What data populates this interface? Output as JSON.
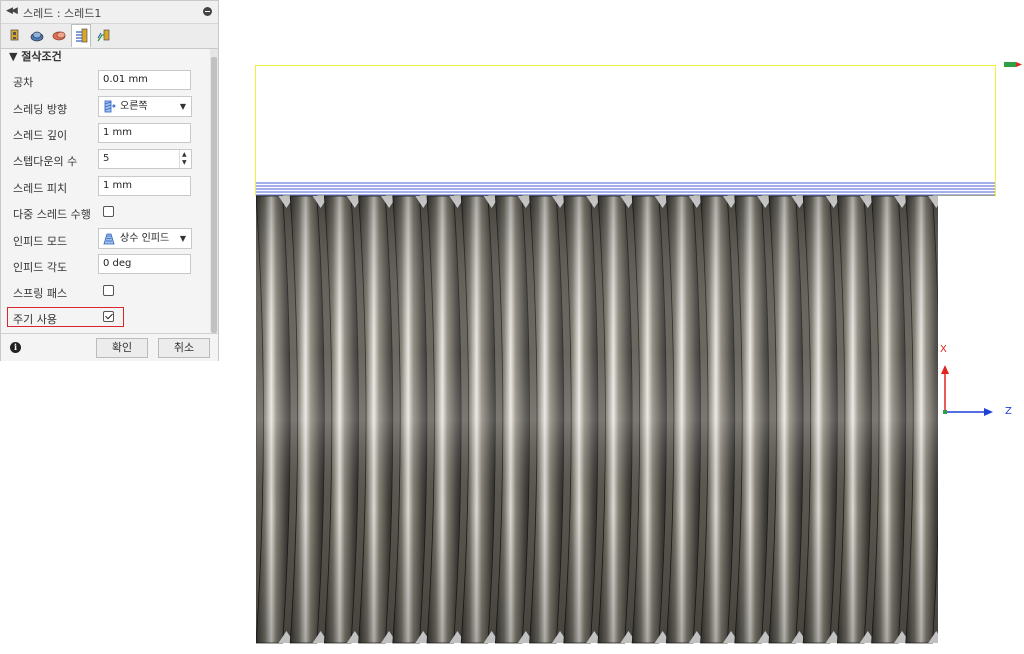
{
  "dialog": {
    "title": "스레드 : 스레드1",
    "section_title": "절삭조건",
    "tabs": [
      {
        "name": "tool-tab"
      },
      {
        "name": "geometry-tab"
      },
      {
        "name": "heights-tab"
      },
      {
        "name": "passes-tab",
        "active": true
      },
      {
        "name": "linking-tab"
      }
    ],
    "rows": [
      {
        "label": "공차",
        "type": "text",
        "value": "0.01 mm"
      },
      {
        "label": "스레딩 방향",
        "type": "dropdown",
        "value": "오른쪽"
      },
      {
        "label": "스레드 깊이",
        "type": "text",
        "value": "1 mm"
      },
      {
        "label": "스텝다운의 수",
        "type": "spinner",
        "value": "5"
      },
      {
        "label": "스레드 피치",
        "type": "text",
        "value": "1 mm"
      },
      {
        "label": "다중 스레드 수행",
        "type": "checkbox",
        "checked": false
      },
      {
        "label": "인피드 모드",
        "type": "dropdown",
        "value": "상수 인피드"
      },
      {
        "label": "인피드 각도",
        "type": "text",
        "value": "0 deg"
      },
      {
        "label": "스프링 패스",
        "type": "checkbox",
        "checked": false
      },
      {
        "label": "주기 사용",
        "type": "checkbox",
        "checked": true
      }
    ],
    "ok_label": "확인",
    "cancel_label": "취소",
    "info_glyph": "i"
  },
  "viewport": {
    "axis_x_label": "X",
    "axis_z_label": "Z",
    "colors": {
      "stock_outline": "#f2ee3a",
      "toolpath": "#4a5cd6",
      "axis_x": "#e0241f",
      "axis_z": "#1f3fd9"
    }
  }
}
